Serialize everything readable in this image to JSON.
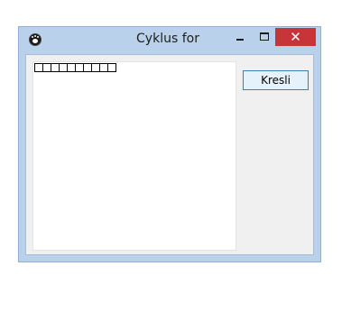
{
  "window": {
    "title": "Cyklus for",
    "controls": {
      "minimize": "minimize-icon",
      "maximize": "maximize-icon",
      "close_symbol": "✕"
    }
  },
  "canvas": {
    "box_count": 10
  },
  "actions": {
    "draw_label": "Kresli"
  },
  "colors": {
    "titlebar": "#b9d1ea",
    "close_button": "#c7343a",
    "button_border": "#3c7fb1"
  }
}
